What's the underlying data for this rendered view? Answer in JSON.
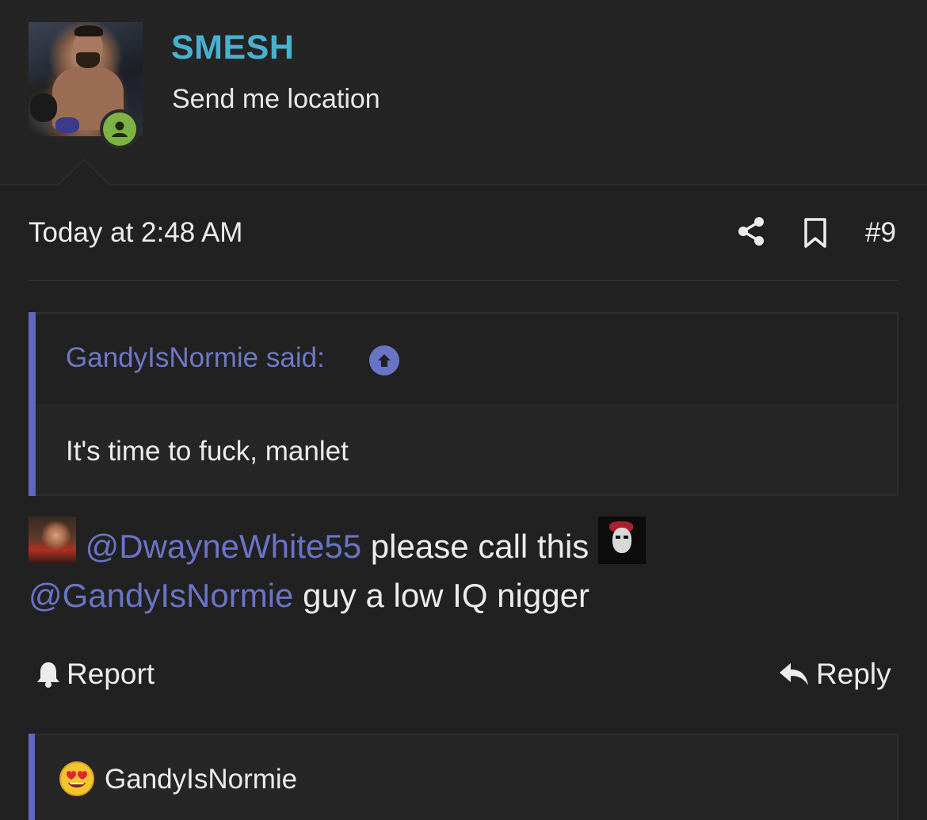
{
  "user": {
    "name": "SMESH",
    "title": "Send me location",
    "status_color": "#7cb342"
  },
  "post": {
    "date": "Today at 2:48 AM",
    "number": "#9",
    "actions": {
      "share_icon": "share-icon",
      "bookmark_icon": "bookmark-icon"
    }
  },
  "quote": {
    "author_label": "GandyIsNormie said:",
    "text": "It's time to fuck, manlet",
    "accent": "#5f68b9"
  },
  "message": {
    "mention1": "@DwayneWhite55",
    "text1": " please call this ",
    "mention2": "@GandyIsNormie",
    "text2": " guy a low IQ nigger"
  },
  "footer": {
    "report_label": "Report",
    "reply_label": "Reply"
  },
  "reactions": {
    "user": "GandyIsNormie",
    "emoji": "heart-eyes"
  }
}
